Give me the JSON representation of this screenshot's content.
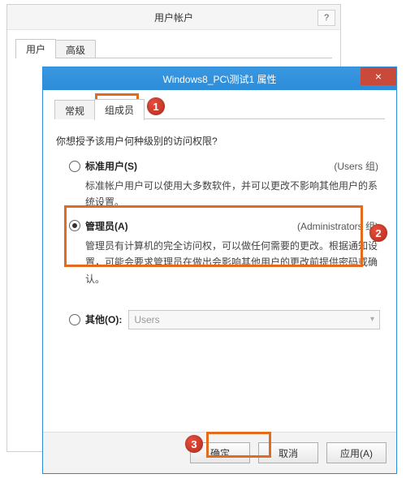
{
  "background_window": {
    "title": "用户帐户",
    "help_label": "?",
    "tabs": {
      "users": "用户",
      "advanced": "高级"
    }
  },
  "dialog": {
    "title": "Windows8_PC\\测试1 属性",
    "close_label": "×",
    "tabs": {
      "general": "常规",
      "membership": "组成员"
    },
    "question": "你想授予该用户何种级别的访问权限?",
    "options": {
      "standard": {
        "label": "标准用户(S)",
        "group": "(Users 组)",
        "desc": "标准帐户用户可以使用大多数软件，并可以更改不影响其他用户的系统设置。",
        "checked": false
      },
      "admin": {
        "label": "管理员(A)",
        "group": "(Administrators 组)",
        "desc": "管理员有计算机的完全访问权，可以做任何需要的更改。根据通知设置，可能会要求管理员在做出会影响其他用户的更改前提供密码或确认。",
        "checked": true
      },
      "other": {
        "label": "其他(O):",
        "selected": "Users",
        "checked": false
      }
    },
    "buttons": {
      "ok": "确定",
      "cancel": "取消",
      "apply": "应用(A)"
    }
  },
  "callouts": {
    "one": "1",
    "two": "2",
    "three": "3"
  }
}
